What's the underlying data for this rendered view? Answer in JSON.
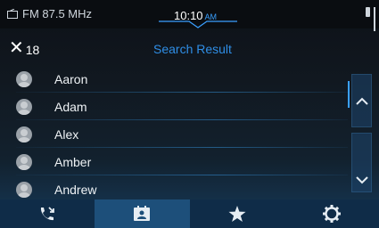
{
  "status": {
    "source": "FM 87.5 MHz",
    "time": "10:10",
    "ampm": "AM"
  },
  "header": {
    "close_glyph": "✕",
    "result_count": "18",
    "title": "Search Result"
  },
  "contacts": [
    {
      "name": "Aaron"
    },
    {
      "name": "Adam"
    },
    {
      "name": "Alex"
    },
    {
      "name": "Amber"
    },
    {
      "name": "Andrew"
    }
  ],
  "nav": {
    "tabs": [
      {
        "icon": "recent-calls-icon",
        "active": false
      },
      {
        "icon": "contacts-icon",
        "active": true
      },
      {
        "icon": "favorites-star-icon",
        "active": false
      },
      {
        "icon": "settings-gear-icon",
        "active": false
      }
    ]
  },
  "colors": {
    "accent": "#2f8ee6",
    "nav_bg": "#0f2c48",
    "nav_active": "#1d4f7a"
  }
}
